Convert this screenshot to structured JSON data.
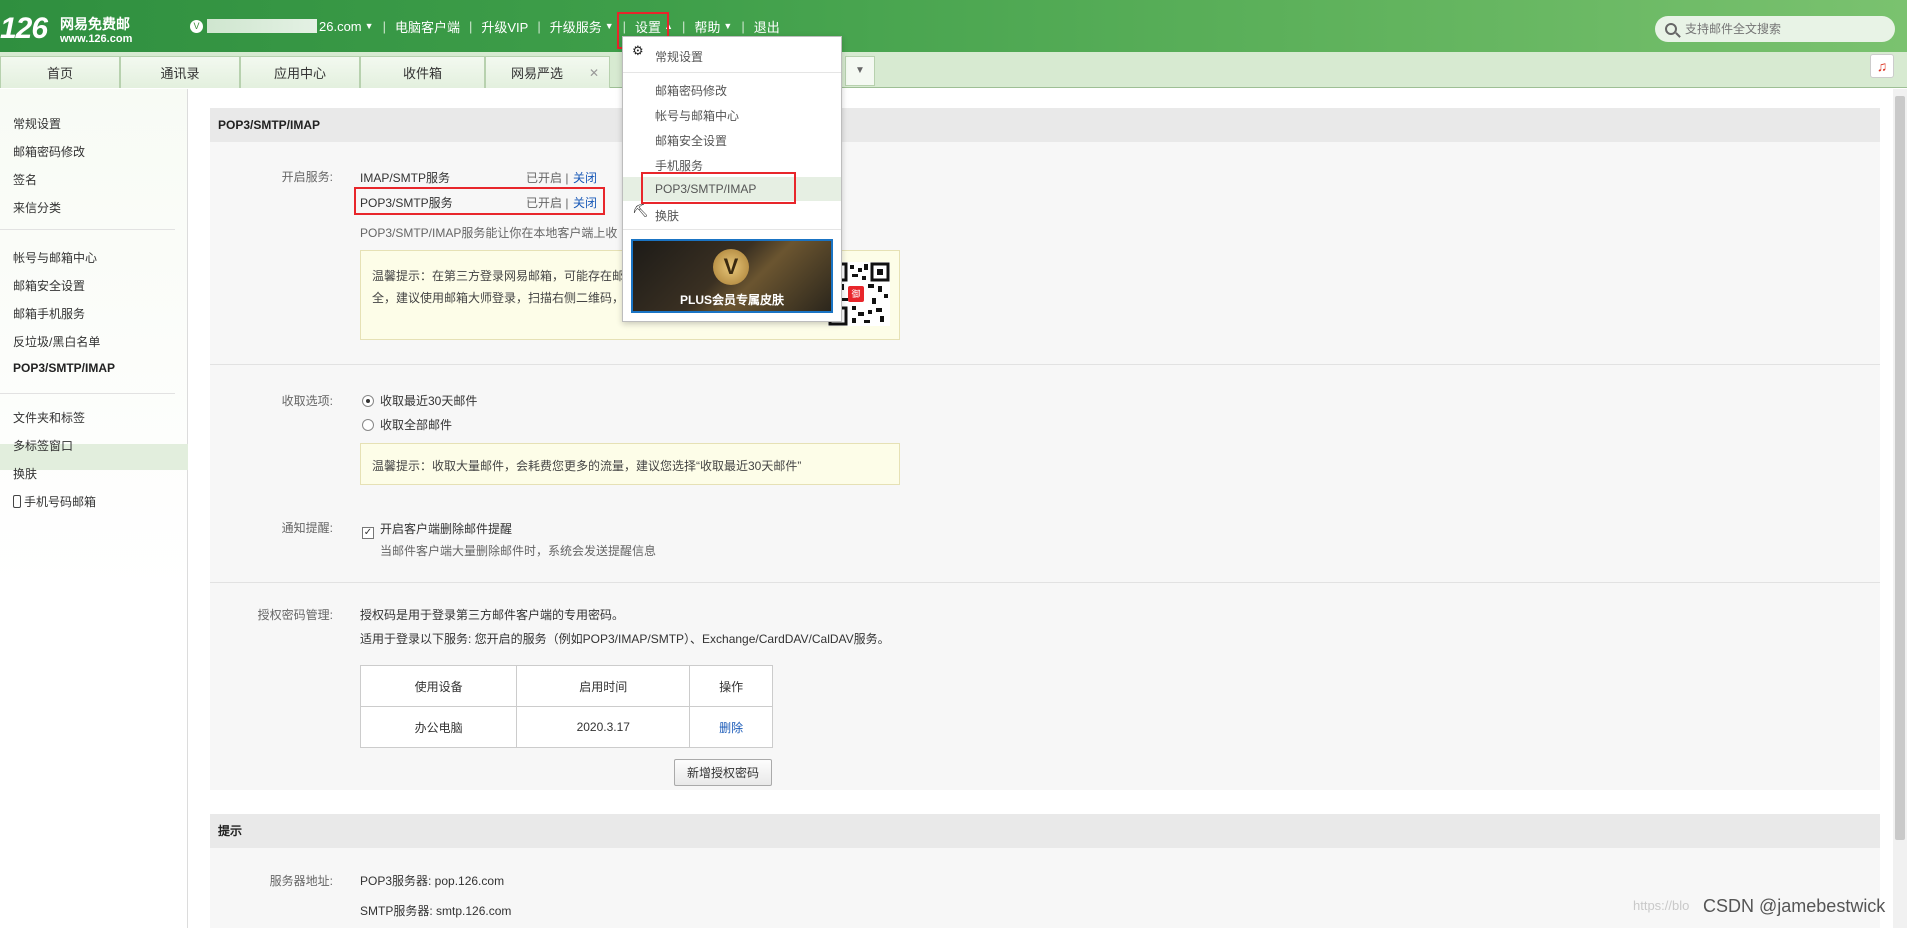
{
  "header": {
    "logo_number": "126",
    "logo_title": "网易免费邮",
    "logo_url": "www.126.com",
    "account_suffix": "26.com",
    "nav": [
      "电脑客户端",
      "升级VIP",
      "升级服务",
      "设置",
      "帮助",
      "退出"
    ],
    "search_placeholder": "支持邮件全文搜索"
  },
  "tabs": [
    "首页",
    "通讯录",
    "应用中心",
    "收件箱",
    "网易严选"
  ],
  "sidebar": {
    "group1": [
      "常规设置",
      "邮箱密码修改",
      "签名",
      "来信分类"
    ],
    "group2": [
      "帐号与邮箱中心",
      "邮箱安全设置",
      "邮箱手机服务",
      "反垃圾/黑白名单",
      "POP3/SMTP/IMAP"
    ],
    "group3": [
      "文件夹和标签",
      "多标签窗口",
      "换肤",
      "手机号码邮箱"
    ]
  },
  "dropdown": {
    "items": [
      "常规设置",
      "邮箱密码修改",
      "帐号与邮箱中心",
      "邮箱安全设置",
      "手机服务",
      "POP3/SMTP/IMAP",
      "换肤"
    ],
    "banner_text": "PLUS会员专属皮肤",
    "banner_badge": "V",
    "qr_badge": "御"
  },
  "section1": {
    "title": "POP3/SMTP/IMAP",
    "service_label": "开启服务:",
    "services": [
      {
        "name": "IMAP/SMTP服务",
        "status": "已开启",
        "sep": "|",
        "action": "关闭"
      },
      {
        "name": "POP3/SMTP服务",
        "status": "已开启",
        "sep": "|",
        "action": "关闭"
      }
    ],
    "service_desc": "POP3/SMTP/IMAP服务能让你在本地客户端上收",
    "tip1_line1": "温馨提示：在第三方登录网易邮箱，可能存在邮",
    "tip1_line2": "全，建议使用邮箱大师登录，扫描右侧二维码，",
    "recv_label": "收取选项:",
    "recv_options": [
      "收取最近30天邮件",
      "收取全部邮件"
    ],
    "tip2": "温馨提示：收取大量邮件，会耗费您更多的流量，建议您选择“收取最近30天邮件”",
    "notify_label": "通知提醒:",
    "notify_option": "开启客户端删除邮件提醒",
    "notify_desc": "当邮件客户端大量删除邮件时，系统会发送提醒信息",
    "auth_label": "授权密码管理:",
    "auth_desc1": "授权码是用于登录第三方邮件客户端的专用密码。",
    "auth_desc2": "适用于登录以下服务: 您开启的服务（例如POP3/IMAP/SMTP）、Exchange/CardDAV/CalDAV服务。",
    "table_headers": [
      "使用设备",
      "启用时间",
      "操作"
    ],
    "table_rows": [
      [
        "办公电脑",
        "2020.3.17",
        "删除"
      ]
    ],
    "new_button": "新增授权密码"
  },
  "section2": {
    "title": "提示",
    "server_label": "服务器地址:",
    "pop3": "POP3服务器: pop.126.com",
    "smtp": "SMTP服务器: smtp.126.com"
  },
  "watermark": "https://blo",
  "watermark_csdn": "CSDN @jamebestwick",
  "colors": {
    "brand_green": "#3a9a45",
    "highlight_red": "#e8262b",
    "link_blue": "#1a5ab8"
  }
}
